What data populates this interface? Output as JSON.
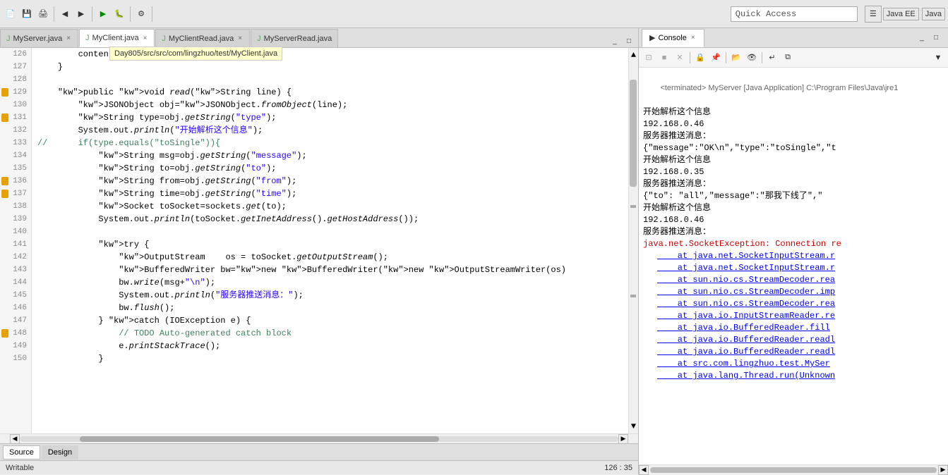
{
  "toolbar": {
    "quick_access_placeholder": "Quick Access",
    "perspective_java_ee": "Java EE",
    "perspective_java": "Java"
  },
  "tabs": [
    {
      "id": "myserver",
      "label": "MyServer.java",
      "active": false
    },
    {
      "id": "myclient",
      "label": "MyClient.java",
      "active": true
    },
    {
      "id": "myclientread",
      "label": "MyClientRead.java",
      "active": false
    },
    {
      "id": "myserverread",
      "label": "MyServerRead.java",
      "active": false
    }
  ],
  "tooltip": {
    "text": "Day805/src/src/com/lingzhuo/test/MyClient.java"
  },
  "code_lines": [
    {
      "num": 126,
      "text": "        contentPane.add(list);"
    },
    {
      "num": 127,
      "text": "    }"
    },
    {
      "num": 128,
      "text": ""
    },
    {
      "num": 129,
      "text": "    public void read(String line) {",
      "marker": true
    },
    {
      "num": 130,
      "text": "        JSONObject obj=JSONObject.fromObject(line);"
    },
    {
      "num": 131,
      "text": "        String type=obj.getString(\"type\");",
      "marker": true
    },
    {
      "num": 132,
      "text": "        System.out.println(\"开始解析这个信息\");"
    },
    {
      "num": 133,
      "text": "//      if(type.equals(\"toSingle\")){",
      "comment": true
    },
    {
      "num": 134,
      "text": "            String msg=obj.getString(\"message\");"
    },
    {
      "num": 135,
      "text": "            String to=obj.getString(\"to\");"
    },
    {
      "num": 136,
      "text": "            String from=obj.getString(\"from\");",
      "marker": true
    },
    {
      "num": 137,
      "text": "            String time=obj.getString(\"time\");",
      "marker": true
    },
    {
      "num": 138,
      "text": "            Socket toSocket=sockets.get(to);"
    },
    {
      "num": 139,
      "text": "            System.out.println(toSocket.getInetAddress().getHostAddress());"
    },
    {
      "num": 140,
      "text": ""
    },
    {
      "num": 141,
      "text": "            try {"
    },
    {
      "num": 142,
      "text": "                OutputStream    os = toSocket.getOutputStream();"
    },
    {
      "num": 143,
      "text": "                BufferedWriter bw=new BufferedWriter(new OutputStreamWriter(os)"
    },
    {
      "num": 144,
      "text": "                bw.write(msg+\"\\n\");"
    },
    {
      "num": 145,
      "text": "                System.out.println(\"服务器推送消息：\");"
    },
    {
      "num": 146,
      "text": "                bw.flush();"
    },
    {
      "num": 147,
      "text": "            } catch (IOException e) {"
    },
    {
      "num": 148,
      "text": "                // TODO Auto-generated catch block",
      "comment": true,
      "marker": true
    },
    {
      "num": 149,
      "text": "                e.printStackTrace();"
    },
    {
      "num": 150,
      "text": "            }"
    }
  ],
  "bottom_tabs": [
    {
      "label": "Source",
      "active": true
    },
    {
      "label": "Design",
      "active": false
    }
  ],
  "console": {
    "title": "Console",
    "terminated_text": "<terminated> MyServer [Java Application] C:\\Program Files\\Java\\jre1",
    "lines": [
      {
        "text": "开始解析这个信息",
        "type": "normal"
      },
      {
        "text": "192.168.0.46",
        "type": "normal"
      },
      {
        "text": "服务器推送消息：",
        "type": "normal"
      },
      {
        "text": "{\"message\":\"OK\\n\",\"type\":\"toSingle\",\"t",
        "type": "normal"
      },
      {
        "text": "开始解析这个信息",
        "type": "normal"
      },
      {
        "text": "192.168.0.35",
        "type": "normal"
      },
      {
        "text": "服务器推送消息：",
        "type": "normal"
      },
      {
        "text": "{\"to\": \"all\",\"message\":\"那我下线了\",\"",
        "type": "normal"
      },
      {
        "text": "开始解析这个信息",
        "type": "normal"
      },
      {
        "text": "192.168.0.46",
        "type": "normal"
      },
      {
        "text": "服务器推送消息：",
        "type": "normal"
      },
      {
        "text": "java.net.SocketException: Connection re",
        "type": "link"
      },
      {
        "text": "\tat java.net.SocketInputStream.r",
        "type": "stack"
      },
      {
        "text": "\tat java.net.SocketInputStream.r",
        "type": "stack"
      },
      {
        "text": "\tat sun.nio.cs.StreamDecoder.rea",
        "type": "stack"
      },
      {
        "text": "\tat sun.nio.cs.StreamDecoder.imp",
        "type": "stack"
      },
      {
        "text": "\tat sun.nio.cs.StreamDecoder.rea",
        "type": "stack"
      },
      {
        "text": "\tat java.io.InputStreamReader.re",
        "type": "stack"
      },
      {
        "text": "\tat java.io.BufferedReader.fill",
        "type": "stack"
      },
      {
        "text": "\tat java.io.BufferedReader.readl",
        "type": "stack"
      },
      {
        "text": "\tat java.io.BufferedReader.readl",
        "type": "stack"
      },
      {
        "text": "\tat src.com.lingzhuo.test.MySer",
        "type": "stack"
      },
      {
        "text": "\tat java.lang.Thread.run(Unknown",
        "type": "stack"
      }
    ]
  },
  "status_bar": {
    "text": "Writable",
    "position": "126 : 35"
  },
  "icons": {
    "java_file": "☕",
    "console": "▶",
    "close": "×",
    "run": "▶",
    "stop": "■",
    "clear": "⊡"
  }
}
